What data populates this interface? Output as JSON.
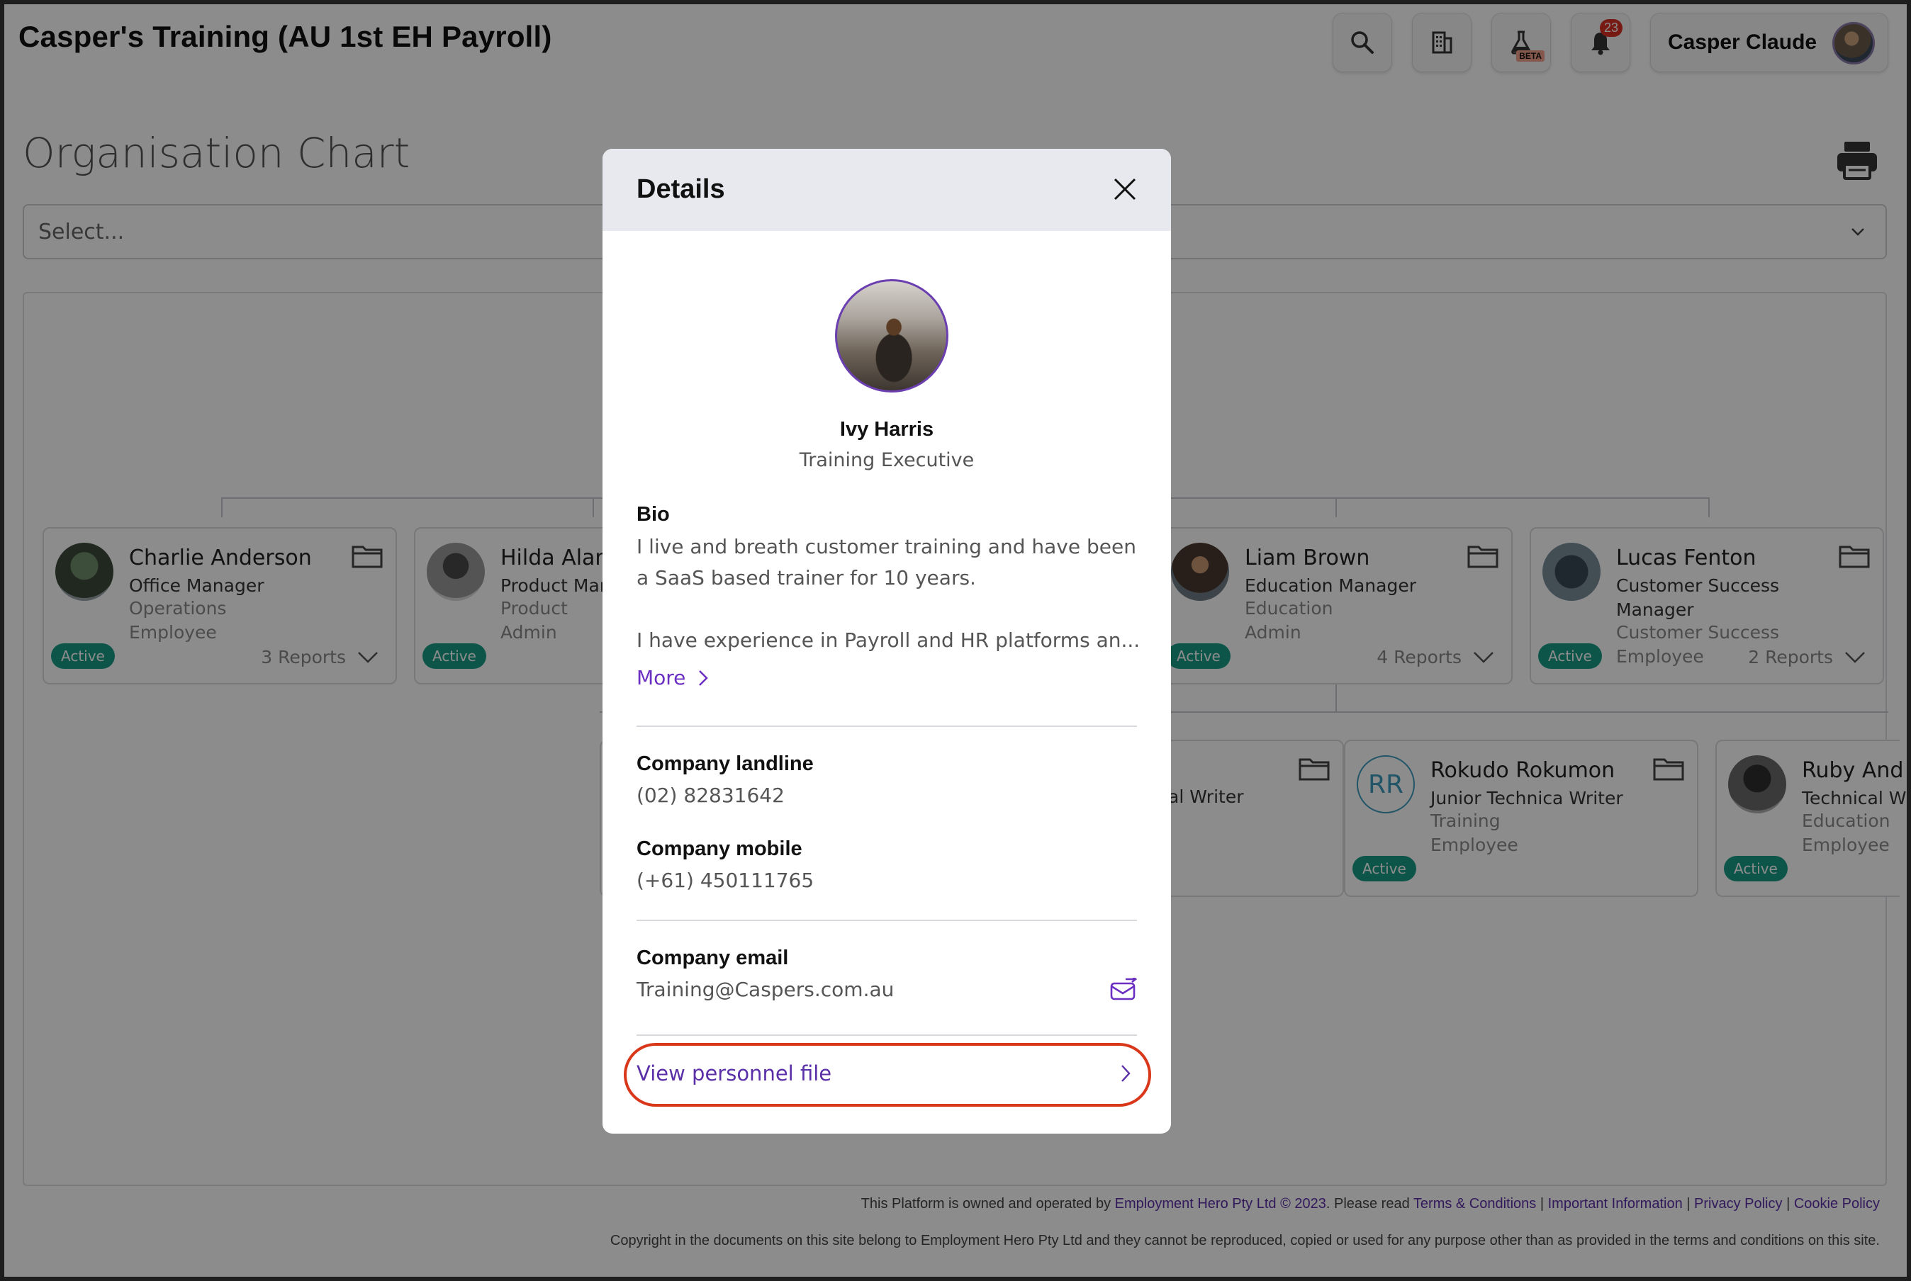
{
  "app": {
    "title": "Casper's Training (AU 1st EH Payroll)",
    "notification_count": "23",
    "beta_label": "BETA",
    "user_name": "Casper Claude"
  },
  "page": {
    "title": "Organisation Chart",
    "select_placeholder": "Select..."
  },
  "cards": [
    {
      "name": "Charlie Anderson",
      "role": "Office Manager",
      "dept": "Operations",
      "level": "Employee",
      "status": "Active",
      "reports": "3 Reports"
    },
    {
      "name": "Hilda Alan",
      "role": "Product Man",
      "dept": "Product",
      "level": "Admin",
      "status": "Active",
      "reports": ""
    },
    {
      "name": "Liam Brown",
      "role": "Education Manager",
      "dept": "Education",
      "level": "Admin",
      "status": "Active",
      "reports": "4 Reports"
    },
    {
      "name": "Lucas Fenton",
      "role": "Customer Success Manager",
      "dept": "Customer Success",
      "level": "Employee",
      "status": "Active",
      "reports": "2 Reports"
    },
    {
      "name": "",
      "role": "al Writer",
      "dept": "",
      "level": "",
      "status": "",
      "reports": ""
    },
    {
      "initials": "RR",
      "name": "Rokudo Rokumon",
      "role": "Junior Technica Writer",
      "dept": "Training",
      "level": "Employee",
      "status": "Active",
      "reports": ""
    },
    {
      "name": "Ruby And",
      "role": "Technical W",
      "dept": "Education",
      "level": "Employee",
      "status": "Active",
      "reports": ""
    }
  ],
  "footer": {
    "line1_prefix": "This Platform is owned and operated by ",
    "company_link": "Employment Hero Pty Ltd © 2023",
    "line1_mid": ". Please read ",
    "terms_link": "Terms & Conditions",
    "sep": " | ",
    "important_link": "Important Information",
    "privacy_link": "Privacy Policy",
    "cookie_link": "Cookie Policy",
    "line2": "Copyright in the documents on this site belong to Employment Hero Pty Ltd and they cannot be reproduced, copied or used for any purpose other than as provided in the terms and conditions on this site."
  },
  "modal": {
    "title": "Details",
    "person_name": "Ivy Harris",
    "person_title": "Training Executive",
    "bio_label": "Bio",
    "bio_p1": "I live and breath customer training and have been a SaaS based trainer for 10 years.",
    "bio_p2": "I have experience in Payroll and HR platforms an...",
    "more_label": "More",
    "landline_label": "Company landline",
    "landline_value": "(02) 82831642",
    "mobile_label": "Company mobile",
    "mobile_value": "(+61) 450111765",
    "email_label": "Company email",
    "email_value": "Training@Caspers.com.au",
    "personnel_link": "View personnel file"
  },
  "colors": {
    "accent_purple": "#5b2fa8",
    "active_badge": "#1a9c86",
    "highlight_ring": "#d9371a",
    "notification_red": "#d93025"
  }
}
